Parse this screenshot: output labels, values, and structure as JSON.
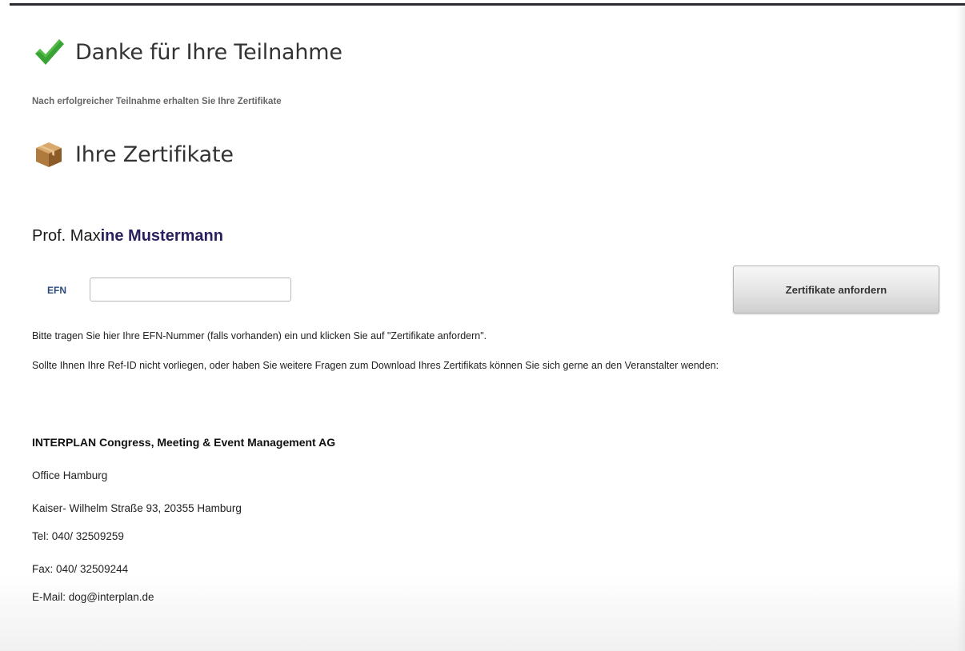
{
  "header": {
    "thanks_title": "Danke für Ihre Teilnahme",
    "thanks_icon": "checkmark-icon",
    "intro_note": "Nach erfolgreicher Teilnahme erhalten Sie Ihre Zertifikate",
    "certs_title": "Ihre Zertifikate",
    "certs_icon": "package-box-icon"
  },
  "participant": {
    "name_prefix": "Prof. Max",
    "name_rest": "ine Mustermann"
  },
  "form": {
    "efn_label": "EFN",
    "efn_value": "",
    "efn_placeholder": "",
    "submit_label": "Zertifikate anfordern"
  },
  "info": {
    "line1": "Bitte tragen Sie hier Ihre EFN-Nummer (falls vorhanden) ein und klicken Sie auf \"Zertifikate anfordern\".",
    "line2": "Sollte Ihnen Ihre Ref-ID nicht vorliegen, oder haben Sie weitere Fragen zum Download Ihres Zertifikats können Sie sich gerne an den Veranstalter wenden:"
  },
  "contact": {
    "organization": "INTERPLAN Congress, Meeting & Event Management AG",
    "office": "Office Hamburg",
    "address": "Kaiser- Wilhelm Straße 93, 20355 Hamburg",
    "tel": "Tel: 040/ 32509259",
    "fax": "Fax: 040/ 32509244",
    "email": "E-Mail: dog@interplan.de"
  },
  "colors": {
    "check_green": "#3aa335",
    "name_accent": "#2a1f5c",
    "efn_label": "#2c4a7c",
    "box_brown": "#b07a3e"
  }
}
